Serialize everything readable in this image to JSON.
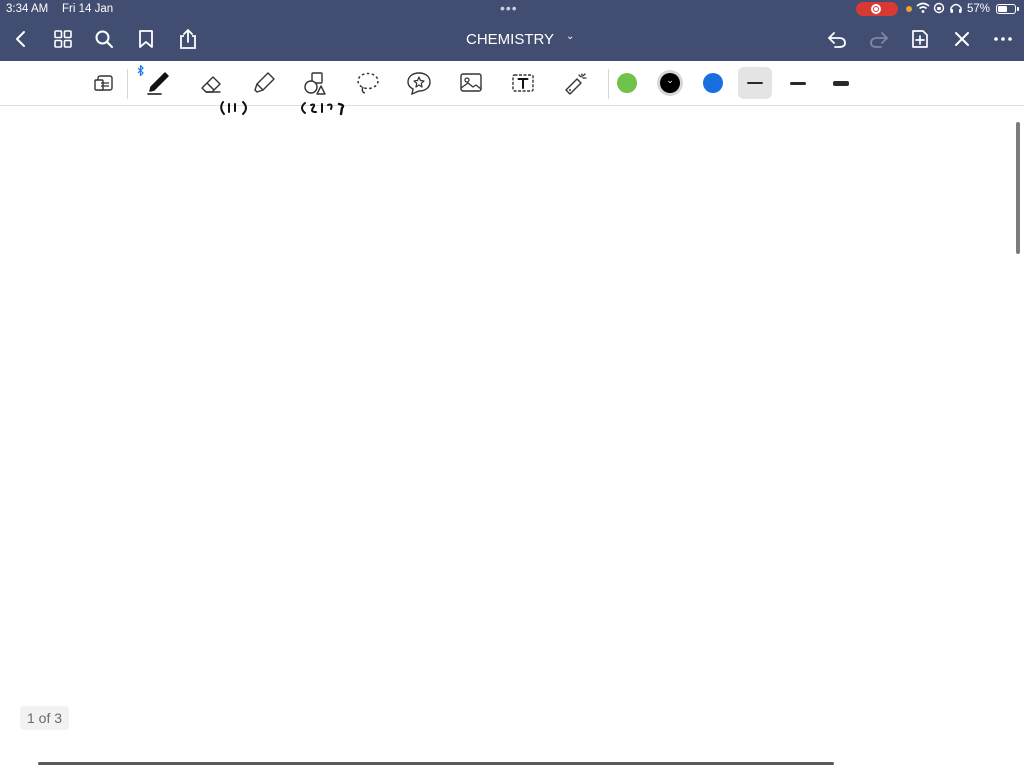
{
  "status_bar": {
    "time": "3:34 AM",
    "date": "Fri 14 Jan",
    "battery_percent": "57%",
    "battery_level": 0.57,
    "recording": true,
    "icons": [
      "record-icon",
      "wifi-icon",
      "rotation-lock-icon",
      "headphones-icon",
      "battery-icon"
    ]
  },
  "nav": {
    "title": "CHEMISTRY",
    "left_icons": [
      "back-icon",
      "thumbnails-icon",
      "search-icon",
      "bookmark-icon",
      "share-icon"
    ],
    "right_icons": [
      "undo-icon",
      "redo-icon",
      "add-page-icon",
      "close-icon",
      "more-icon"
    ]
  },
  "toolbar": {
    "tools": [
      "read-only-mode",
      "pen",
      "eraser",
      "highlighter",
      "shapes",
      "lasso",
      "elements",
      "image",
      "text",
      "laser-pointer"
    ],
    "selected_tool": "pen",
    "colors": [
      "#6fc24a",
      "#000000",
      "#1a6fe0"
    ],
    "selected_color": "#000000",
    "stroke_widths": [
      "thin",
      "medium",
      "thick"
    ],
    "selected_stroke": "thin"
  },
  "canvas": {
    "page_indicator": "1 of 3"
  },
  "colors": {
    "nav_bg": "#414e72",
    "accent_blue": "#1a7ae6",
    "record_red": "#d83a33"
  }
}
